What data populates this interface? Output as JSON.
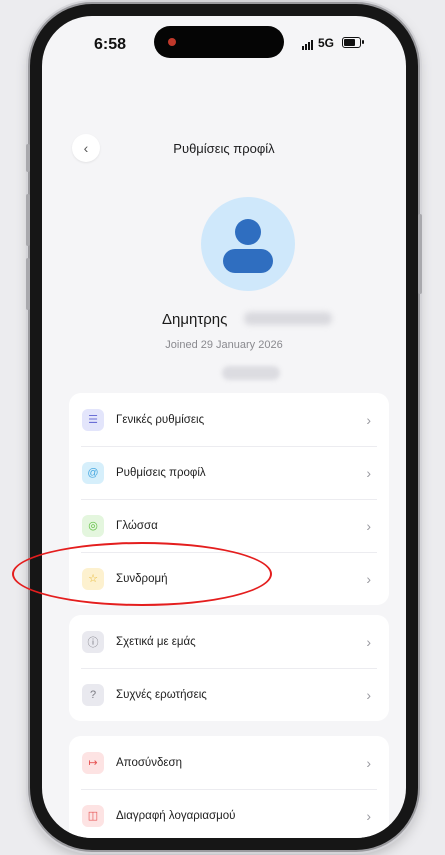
{
  "status_bar": {
    "time": "6:58",
    "network": "5G"
  },
  "header": {
    "back_icon": "chevron-left-icon",
    "title": "Ρυθμίσεις προφίλ"
  },
  "profile": {
    "name": "Δημητρης",
    "joined": "Joined 29 January 2026",
    "avatar_color": "#2f6ec0",
    "avatar_bg": "#cfe8fb"
  },
  "menu_groups": [
    {
      "items": [
        {
          "label": "Γενικές ρυθμίσεις",
          "icon": "sliders-icon",
          "icon_bg": "#e3e5fb",
          "icon_color": "#6b6fd6"
        },
        {
          "label": "Ρυθμίσεις προφίλ",
          "icon": "at-sign-icon",
          "icon_bg": "#d6effb",
          "icon_color": "#4aa9e0"
        },
        {
          "label": "Γλώσσα",
          "icon": "globe-icon",
          "icon_bg": "#e4f6de",
          "icon_color": "#5cbf3e"
        },
        {
          "label": "Συνδρομή",
          "icon": "star-icon",
          "icon_bg": "#fdf1cf",
          "icon_color": "#e5b52a"
        }
      ]
    },
    {
      "items": [
        {
          "label": "Σχετικά με εμάς",
          "icon": "info-icon",
          "icon_bg": "#e9e9ef",
          "icon_color": "#7a7a82"
        },
        {
          "label": "Συχνές ερωτήσεις",
          "icon": "question-icon",
          "icon_bg": "#e9e9ef",
          "icon_color": "#7a7a82"
        }
      ]
    },
    {
      "items": [
        {
          "label": "Αποσύνδεση",
          "icon": "logout-icon",
          "icon_bg": "#fde3e3",
          "icon_color": "#e65353"
        },
        {
          "label": "Διαγραφή λογαριασμού",
          "icon": "trash-icon",
          "icon_bg": "#fde3e3",
          "icon_color": "#e65353"
        }
      ]
    }
  ],
  "highlight": {
    "target": "Συνδρομή",
    "color": "#e41e1e"
  }
}
